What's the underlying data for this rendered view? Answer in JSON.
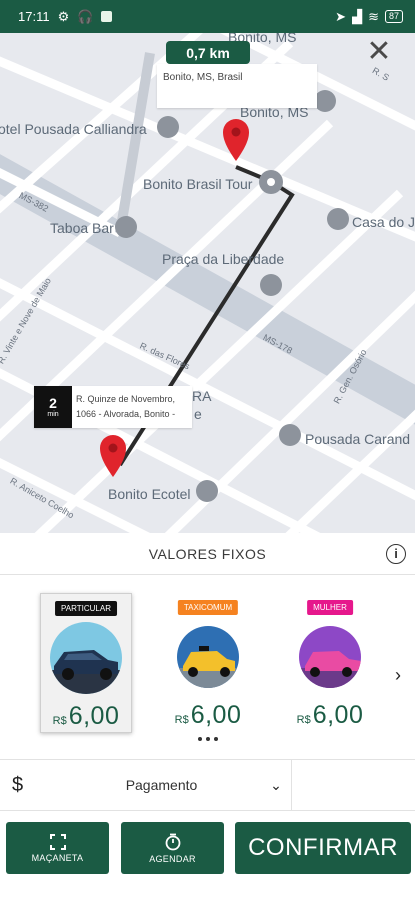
{
  "status_bar": {
    "time": "17:11",
    "battery": "87"
  },
  "map": {
    "distance": "0,7 km",
    "destination_address": "Bonito, MS, Brasil",
    "origin": {
      "eta_value": "2",
      "eta_unit": "min",
      "address_line1": "R. Quinze de Novembro,",
      "address_line2": "1066 - Alvorada, Bonito -"
    },
    "poi_labels": {
      "bonito_ms_top": "Bonito, MS",
      "pousada": "otel Pousada Calliandra",
      "bonito_ms": "Bonito, MS",
      "tour": "Bonito Brasil Tour",
      "casa": "Casa do J",
      "taboa": "Taboa Bar",
      "praca": "Praça da Liberdade",
      "pousada_caranda": "Pousada Carand",
      "ecotel": "Bonito Ecotel",
      "ra": "RA",
      "e": "e"
    },
    "road_labels": {
      "ms382": "MS-382",
      "ms178": "MS-178",
      "vinte_nove": "R. Vinte e Nove de Maio",
      "flores": "R. das Flores",
      "gen_osorio": "R. Gen. Osório",
      "aniceto": "R. Aniceto Coelho",
      "rs": "R. S"
    }
  },
  "panel": {
    "title": "VALORES FIXOS",
    "vehicles": [
      {
        "tag": "PARTICULAR",
        "currency": "R$",
        "price": "6,00",
        "tag_bg": "#111111",
        "tag_fg": "#ffffff",
        "car_color": "#1f3350",
        "bg_color": "#7ec8e3"
      },
      {
        "tag": "TAXICOMUM",
        "currency": "R$",
        "price": "6,00",
        "tag_bg": "#f58220",
        "tag_fg": "#ffffff",
        "car_color": "#f3c02b",
        "bg_color": "#2e6fb3"
      },
      {
        "tag": "MULHER",
        "currency": "R$",
        "price": "6,00",
        "tag_bg": "#e6178c",
        "tag_fg": "#ffffff",
        "car_color": "#e94ba3",
        "bg_color": "#8d48c6"
      }
    ],
    "payment_label": "Pagamento",
    "buttons": {
      "handle": "MAÇANETA",
      "schedule": "AGENDAR",
      "confirm": "CONFIRMAR"
    }
  },
  "colors": {
    "brand": "#1b5b44",
    "pin": "#e0242c",
    "route": "#2b2b2b",
    "map_bg": "#e7e9ee"
  }
}
